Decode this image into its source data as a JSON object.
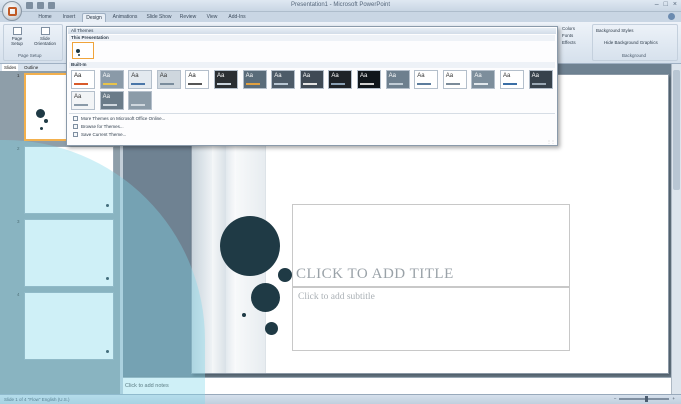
{
  "window": {
    "title": "Presentation1 - Microsoft PowerPoint",
    "controls": [
      "–",
      "□",
      "×"
    ]
  },
  "tabs": [
    "Home",
    "Insert",
    "Design",
    "Animations",
    "Slide Show",
    "Review",
    "View",
    "Add-Ins"
  ],
  "active_tab": "Design",
  "ribbon": {
    "page_setup_label": "Page Setup",
    "page_setup_btn": "Page Setup",
    "orientation_btn": "Slide Orientation",
    "colors_btn": "Colors",
    "fonts_btn": "Fonts",
    "effects_btn": "Effects",
    "bg_styles_btn": "Background Styles",
    "hide_bg_btn": "Hide Background Graphics",
    "background_label": "Background"
  },
  "panel": {
    "tab_slides": "Slides",
    "tab_outline": "Outline",
    "close": "×",
    "numbers": [
      "1",
      "2",
      "3",
      "4"
    ]
  },
  "gallery": {
    "header": "All Themes",
    "this_presentation": "This Presentation",
    "built_in": "Built-In",
    "tiles_row1": [
      {
        "text": "Aa",
        "bg": "#ffffff",
        "fg": "#222222",
        "bar": "#d85a2a"
      },
      {
        "text": "Aa",
        "bg": "#8a9aa8",
        "fg": "#ffffff",
        "bar": "#e8c34a"
      },
      {
        "text": "Aa",
        "bg": "#e3e9ef",
        "fg": "#333333",
        "bar": "#4a76a8"
      },
      {
        "text": "Aa",
        "bg": "#cfd7de",
        "fg": "#333333",
        "bar": "#7a8c9c"
      },
      {
        "text": "Aa",
        "bg": "#ffffff",
        "fg": "#222222",
        "bar": "#555555"
      },
      {
        "text": "Aa",
        "bg": "#2b2f33",
        "fg": "#ffffff",
        "bar": "#c9d3dc"
      },
      {
        "text": "Aa",
        "bg": "#5a6c7a",
        "fg": "#ffffff",
        "bar": "#e0a040"
      },
      {
        "text": "Aa",
        "bg": "#4d5b68",
        "fg": "#ffffff",
        "bar": "#b8c6d3"
      },
      {
        "text": "Aa",
        "bg": "#3f4a55",
        "fg": "#ffffff",
        "bar": "#e3e3e3"
      },
      {
        "text": "Aa",
        "bg": "#1e2328",
        "fg": "#ffffff",
        "bar": "#8aa0b4"
      },
      {
        "text": "Aa",
        "bg": "#10161b",
        "fg": "#ffffff",
        "bar": "#d0d0d0"
      },
      {
        "text": "Aa",
        "bg": "#6d7f8e",
        "fg": "#ffffff",
        "bar": "#c0ccd6"
      },
      {
        "text": "Aa",
        "bg": "#ffffff",
        "fg": "#333333",
        "bar": "#5c7c9c"
      },
      {
        "text": "Aa",
        "bg": "#ffffff",
        "fg": "#333333",
        "bar": "#7b8b99"
      },
      {
        "text": "Aa",
        "bg": "#7d8e9c",
        "fg": "#ffffff",
        "bar": "#e1e7ec"
      },
      {
        "text": "Aa",
        "bg": "#ffffff",
        "fg": "#333333",
        "bar": "#3a6ea5"
      },
      {
        "text": "Aa",
        "bg": "#37424c",
        "fg": "#ffffff",
        "bar": "#9aa8b4"
      }
    ],
    "tiles_row2": [
      {
        "text": "Aa",
        "bg": "#f2f4f6",
        "fg": "#333333",
        "bar": "#8a9aa8"
      },
      {
        "text": "Aa",
        "bg": "#6a7b89",
        "fg": "#ffffff",
        "bar": "#cfd7de"
      },
      {
        "text": "",
        "bg": "#8b9ba8",
        "fg": "#ffffff",
        "bar": "#cfd7de"
      }
    ],
    "link_more": "More Themes on Microsoft Office Online...",
    "link_browse": "Browse for Themes...",
    "link_save": "Save Current Theme..."
  },
  "slide": {
    "title_placeholder": "Click to add title",
    "subtitle_placeholder": "Click to add subtitle",
    "circle_color": "#1f3a45"
  },
  "notes": {
    "placeholder": "Click to add notes"
  },
  "status": {
    "left": "Slide 1 of 4   \"Flow\"   English (U.S.)",
    "zoom_level": 0.55
  },
  "overlay_color": "#82d7eb"
}
